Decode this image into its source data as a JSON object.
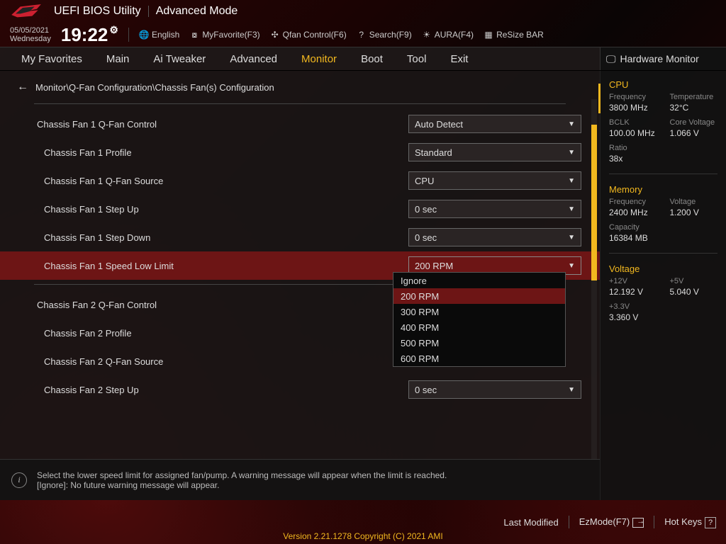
{
  "title": {
    "app": "UEFI BIOS Utility",
    "mode": "Advanced Mode"
  },
  "datetime": {
    "date": "05/05/2021",
    "day": "Wednesday",
    "time": "19:22"
  },
  "toolbar": {
    "language": "English",
    "myfav": "MyFavorite(F3)",
    "qfan": "Qfan Control(F6)",
    "search": "Search(F9)",
    "aura": "AURA(F4)",
    "resize": "ReSize BAR"
  },
  "tabs": [
    "My Favorites",
    "Main",
    "Ai Tweaker",
    "Advanced",
    "Monitor",
    "Boot",
    "Tool",
    "Exit"
  ],
  "active_tab": "Monitor",
  "hw_header": "Hardware Monitor",
  "breadcrumb": "Monitor\\Q-Fan Configuration\\Chassis Fan(s) Configuration",
  "settings": [
    {
      "label": "Chassis Fan 1 Q-Fan Control",
      "value": "Auto Detect",
      "indent": 1
    },
    {
      "label": "Chassis Fan 1 Profile",
      "value": "Standard",
      "indent": 2
    },
    {
      "label": "Chassis Fan 1 Q-Fan Source",
      "value": "CPU",
      "indent": 2
    },
    {
      "label": "Chassis Fan 1 Step Up",
      "value": "0 sec",
      "indent": 2
    },
    {
      "label": "Chassis Fan 1 Step Down",
      "value": "0 sec",
      "indent": 2
    },
    {
      "label": "Chassis Fan 1 Speed Low Limit",
      "value": "200 RPM",
      "indent": 2,
      "selected": true
    },
    {
      "label": "Chassis Fan 2 Q-Fan Control",
      "value": "",
      "indent": 1
    },
    {
      "label": "Chassis Fan 2 Profile",
      "value": "",
      "indent": 2
    },
    {
      "label": "Chassis Fan 2 Q-Fan Source",
      "value": "",
      "indent": 2
    },
    {
      "label": "Chassis Fan 2 Step Up",
      "value": "0 sec",
      "indent": 2
    }
  ],
  "dropdown": {
    "options": [
      "Ignore",
      "200 RPM",
      "300 RPM",
      "400 RPM",
      "500 RPM",
      "600 RPM"
    ],
    "selected": "200 RPM"
  },
  "help": {
    "line1": "Select the lower speed limit for assigned fan/pump. A warning message will appear when the limit is reached.",
    "line2": "[Ignore]: No future warning message will appear."
  },
  "side": {
    "cpu": {
      "title": "CPU",
      "freq_lbl": "Frequency",
      "freq": "3800 MHz",
      "temp_lbl": "Temperature",
      "temp": "32°C",
      "bclk_lbl": "BCLK",
      "bclk": "100.00 MHz",
      "cv_lbl": "Core Voltage",
      "cv": "1.066 V",
      "ratio_lbl": "Ratio",
      "ratio": "38x"
    },
    "mem": {
      "title": "Memory",
      "freq_lbl": "Frequency",
      "freq": "2400 MHz",
      "volt_lbl": "Voltage",
      "volt": "1.200 V",
      "cap_lbl": "Capacity",
      "cap": "16384 MB"
    },
    "volt": {
      "title": "Voltage",
      "v12_lbl": "+12V",
      "v12": "12.192 V",
      "v5_lbl": "+5V",
      "v5": "5.040 V",
      "v33_lbl": "+3.3V",
      "v33": "3.360 V"
    }
  },
  "footer": {
    "last_mod": "Last Modified",
    "ezmode": "EzMode(F7)",
    "hotkeys": "Hot Keys",
    "version": "Version 2.21.1278 Copyright (C) 2021 AMI"
  }
}
